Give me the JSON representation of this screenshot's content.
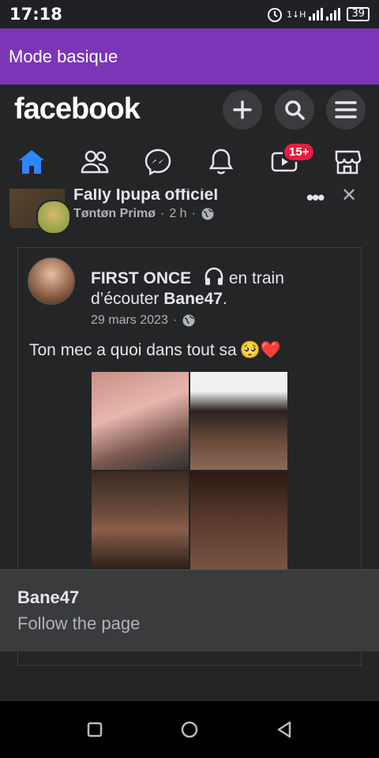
{
  "status_bar": {
    "time": "17:18",
    "network": "4G",
    "battery": "39"
  },
  "mode_bar": {
    "title": "Mode basique"
  },
  "header": {
    "logo": "facebook",
    "buttons": [
      "add-icon",
      "search-icon",
      "menu-icon"
    ]
  },
  "nav": {
    "items": [
      "home-icon",
      "friends-icon",
      "messenger-icon",
      "notifications-icon",
      "video-icon",
      "marketplace-icon"
    ],
    "video_badge": "15+"
  },
  "post": {
    "page_name": "Fally Ipupa officiel",
    "author": "Tøntøn Primø",
    "time": "2 h",
    "shared": {
      "name": "FIRST ONCE",
      "activity_prefix": "en train",
      "activity_line2_prefix": "d’écouter",
      "activity_object": "Bane47",
      "activity_suffix": ".",
      "date": "29 mars 2023",
      "text": "Ton mec a quoi dans tout sa",
      "emojis": "🥺❤️"
    }
  },
  "sheet": {
    "title": "Bane47",
    "subtitle": "Follow the page"
  }
}
